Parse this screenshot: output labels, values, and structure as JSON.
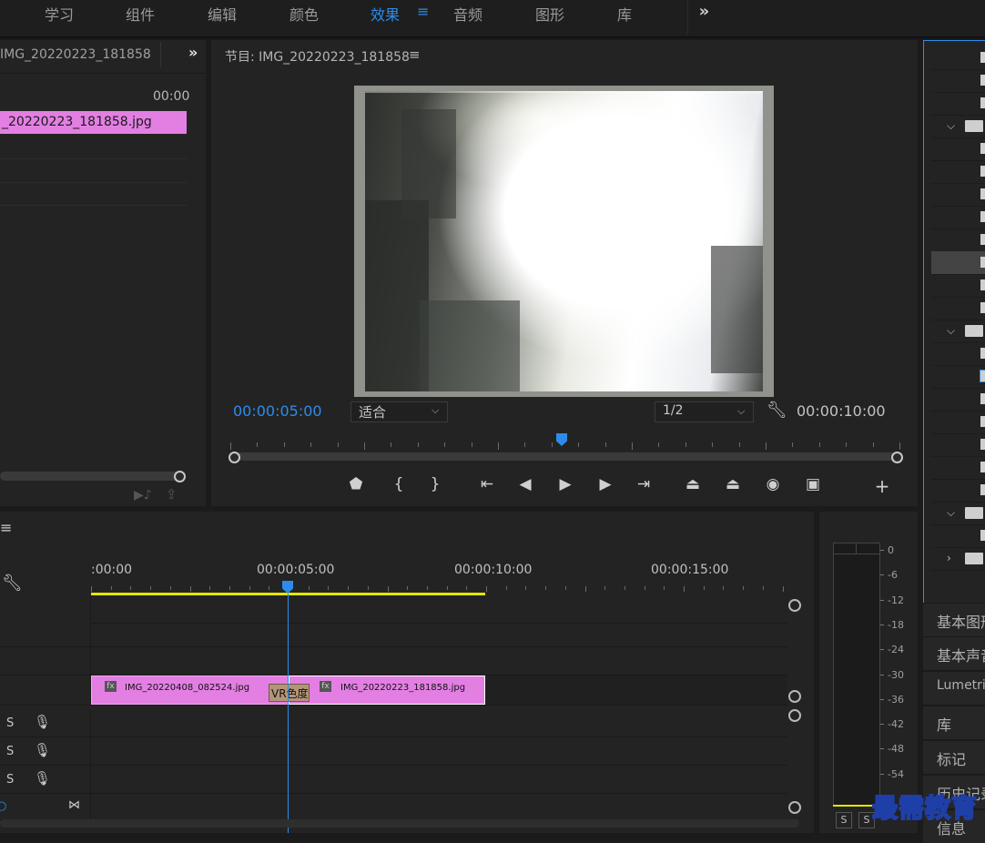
{
  "workspaces": {
    "items": [
      "学习",
      "组件",
      "编辑",
      "颜色",
      "效果",
      "音频",
      "图形",
      "库"
    ],
    "active": "效果",
    "active_menu_icon": "≡",
    "overflow_icon": "»"
  },
  "source_panel": {
    "title": "IMG_20220223_181858",
    "overflow_icon": "»",
    "timecode": "00:00",
    "clip_label": "_20220223_181858.jpg"
  },
  "program_monitor": {
    "title": "节目: IMG_20220223_181858",
    "menu_icon": "≡",
    "current_timecode": "00:00:05:00",
    "fit_label": "适合",
    "resolution_label": "1/2",
    "duration_timecode": "00:00:10:00",
    "wrench_icon": "wrench-icon"
  },
  "right_panel": {
    "tabs": [
      "基本图形",
      "基本声音",
      "Lumetri",
      "库",
      "标记",
      "历史记录",
      "信息"
    ]
  },
  "timeline": {
    "menu_icon": "≡",
    "ruler_labels": [
      ":00:00",
      "00:00:05:00",
      "00:00:10:00",
      "00:00:15:00"
    ],
    "clips": [
      {
        "label": "IMG_20220408_082524.jpg",
        "fx": "fx"
      },
      {
        "label": "IMG_20220223_181858.jpg",
        "fx": "fx"
      }
    ],
    "transition_label": "VR色度",
    "solo_label": "S",
    "audio_tracks": 3
  },
  "audio_meter": {
    "scale": [
      "0",
      "-6",
      "-12",
      "-18",
      "-24",
      "-30",
      "-36",
      "-42",
      "-48",
      "-54"
    ],
    "solo_labels": [
      "S",
      "S"
    ]
  },
  "watermark": "最需教育",
  "colors": {
    "accent": "#2d8ceb",
    "clip": "#e37fe3",
    "work_area": "#e6e600"
  }
}
